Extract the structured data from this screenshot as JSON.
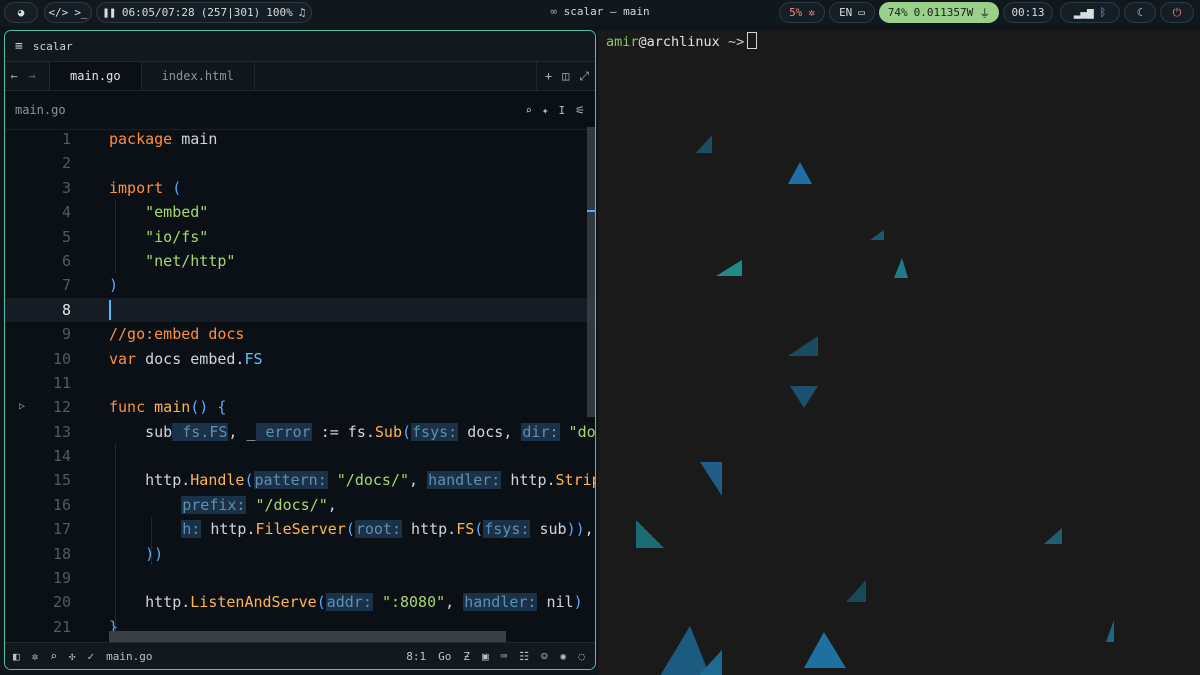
{
  "topbar": {
    "player_time": "06:05/07:28",
    "player_info": "(257|301)",
    "volume": "100%",
    "window_title": "scalar — main",
    "cpu": "5%",
    "lang": "EN",
    "battery": "74%",
    "power": "0.011357W",
    "clock": "00:13"
  },
  "editor": {
    "title": "scalar",
    "tabs": [
      {
        "label": "main.go",
        "active": true
      },
      {
        "label": "index.html",
        "active": false
      }
    ],
    "breadcrumb": "main.go",
    "current_line": 8,
    "status": {
      "file": "main.go",
      "position": "8:1",
      "language": "Go"
    },
    "line_numbers": [
      "1",
      "2",
      "3",
      "4",
      "5",
      "6",
      "7",
      "8",
      "9",
      "10",
      "11",
      "12",
      "13",
      "14",
      "15",
      "16",
      "17",
      "18",
      "19",
      "20",
      "21"
    ]
  },
  "code_tokens": {
    "l1": [
      "package",
      " main"
    ],
    "l3": [
      "import",
      " ("
    ],
    "l4": "\"embed\"",
    "l5": "\"io/fs\"",
    "l6": "\"net/http\"",
    "l7": ")",
    "l9": "//go:embed docs",
    "l10": [
      "var",
      " docs embed.",
      "FS"
    ],
    "l12": [
      "func",
      " ",
      "main",
      "()",
      " {"
    ],
    "l13": [
      "sub",
      " fs.FS",
      ", _",
      " error",
      " := fs.",
      "Sub",
      "(",
      "fsys:",
      " docs, ",
      "dir:",
      " \"doc"
    ],
    "l15": [
      "http.",
      "Handle",
      "(",
      "pattern:",
      " ",
      "\"/docs/\"",
      ", ",
      "handler:",
      " http.",
      "Strip"
    ],
    "l16": [
      "prefix:",
      " ",
      "\"/docs/\"",
      ","
    ],
    "l17": [
      "h:",
      " http.",
      "FileServer",
      "(",
      "root:",
      " http.",
      "FS",
      "(",
      "fsys:",
      " sub",
      "))",
      ","
    ],
    "l18": "))",
    "l20": [
      "http.",
      "ListenAndServe",
      "(",
      "addr:",
      " ",
      "\":8080\"",
      ", ",
      "handler:",
      " nil",
      ")"
    ],
    "l21": "}"
  },
  "terminal": {
    "user": "amir",
    "at": "@",
    "host": "archlinux",
    "path": " ~>"
  },
  "colors": {
    "accent": "#4fc2b0",
    "keyword": "#ff8f40",
    "string": "#a6d86f",
    "function": "#ffb454",
    "type": "#59c2ff",
    "battery_pill": "#9ad08a"
  },
  "icons": [
    "arch-logo-icon",
    "code-icon",
    "terminal-icon",
    "pause-icon",
    "music-icon",
    "cpu-icon",
    "keyboard-icon",
    "plug-icon",
    "wifi-icon",
    "bluetooth-icon",
    "moon-icon",
    "power-icon"
  ]
}
